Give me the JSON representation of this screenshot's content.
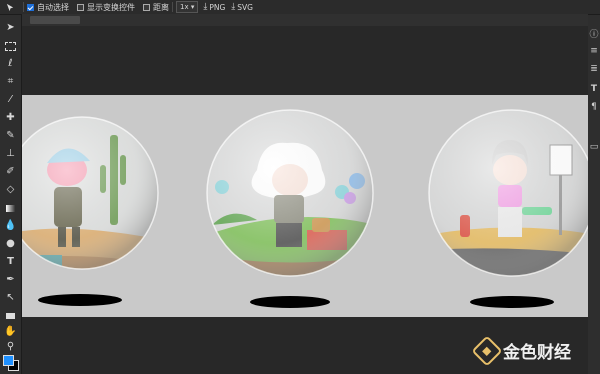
{
  "toolbar": {
    "auto_select_label": "自动选择",
    "auto_select_checked": true,
    "show_transform_label": "显示变换控件",
    "show_transform_checked": false,
    "distance_label": "距离",
    "distance_checked": false,
    "zoom_value": "1x",
    "png_label": "PNG",
    "svg_label": "SVG"
  },
  "watermark": {
    "text": "金色财经"
  },
  "colors": {
    "foreground": "#1e90ff",
    "background": "#000000",
    "canvas": "#c9c9c9"
  },
  "icons": {
    "left": [
      "move-icon",
      "marquee-icon",
      "lasso-icon",
      "crop-icon",
      "eyedropper-icon",
      "healing-icon",
      "brush-icon",
      "stamp-icon",
      "history-brush-icon",
      "eraser-icon",
      "gradient-icon",
      "blur-icon",
      "dodge-icon",
      "pen-icon",
      "type-icon",
      "path-select-icon",
      "shape-icon",
      "hand-icon",
      "zoom-icon"
    ],
    "right": [
      "info-icon",
      "layers-icon",
      "paragraph-icon",
      "type-icon",
      "character-icon",
      "image-icon"
    ]
  }
}
